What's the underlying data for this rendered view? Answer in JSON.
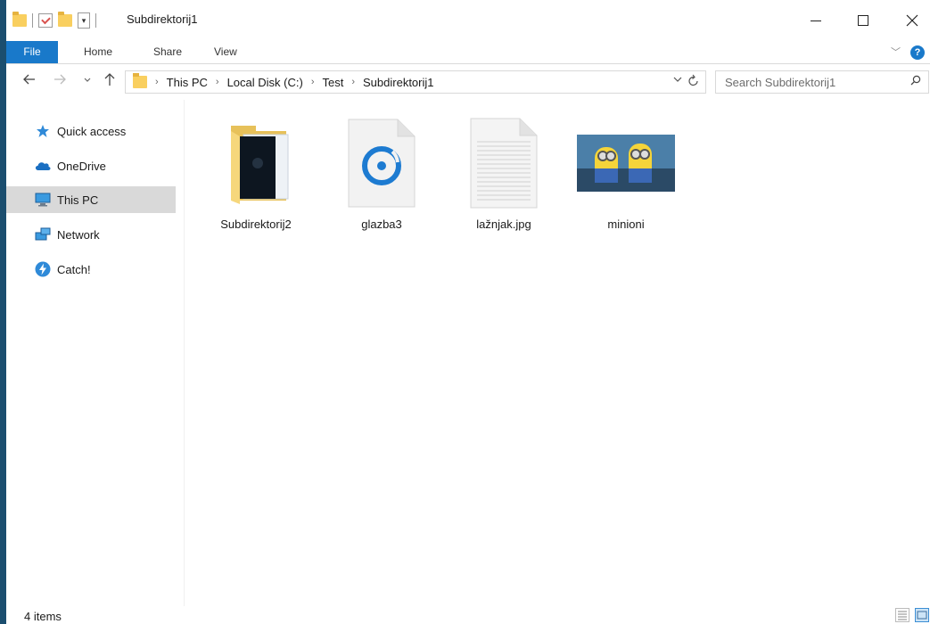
{
  "window": {
    "title": "Subdirektorij1"
  },
  "ribbon": {
    "tabs": [
      {
        "label": "File"
      },
      {
        "label": "Home"
      },
      {
        "label": "Share"
      },
      {
        "label": "View"
      }
    ],
    "help_label": "?"
  },
  "address": {
    "crumbs": [
      "This PC",
      "Local Disk (C:)",
      "Test",
      "Subdirektorij1"
    ]
  },
  "search": {
    "placeholder": "Search Subdirektorij1"
  },
  "nav": {
    "items": [
      {
        "label": "Quick access",
        "icon": "star-icon"
      },
      {
        "label": "OneDrive",
        "icon": "cloud-icon"
      },
      {
        "label": "This PC",
        "icon": "computer-icon",
        "selected": true
      },
      {
        "label": "Network",
        "icon": "network-icon"
      },
      {
        "label": "Catch!",
        "icon": "lightning-icon"
      }
    ]
  },
  "files": [
    {
      "name": "Subdirektorij2",
      "type": "folder"
    },
    {
      "name": "glazba3",
      "type": "audio"
    },
    {
      "name": "lažnjak.jpg",
      "type": "text"
    },
    {
      "name": "minioni",
      "type": "image"
    }
  ],
  "status": {
    "count": "4 items"
  },
  "colors": {
    "accent": "#1979ca",
    "folder": "#f9cf5f",
    "selected_bg": "#d9d9d9",
    "window_border": "#1b4e6f"
  }
}
